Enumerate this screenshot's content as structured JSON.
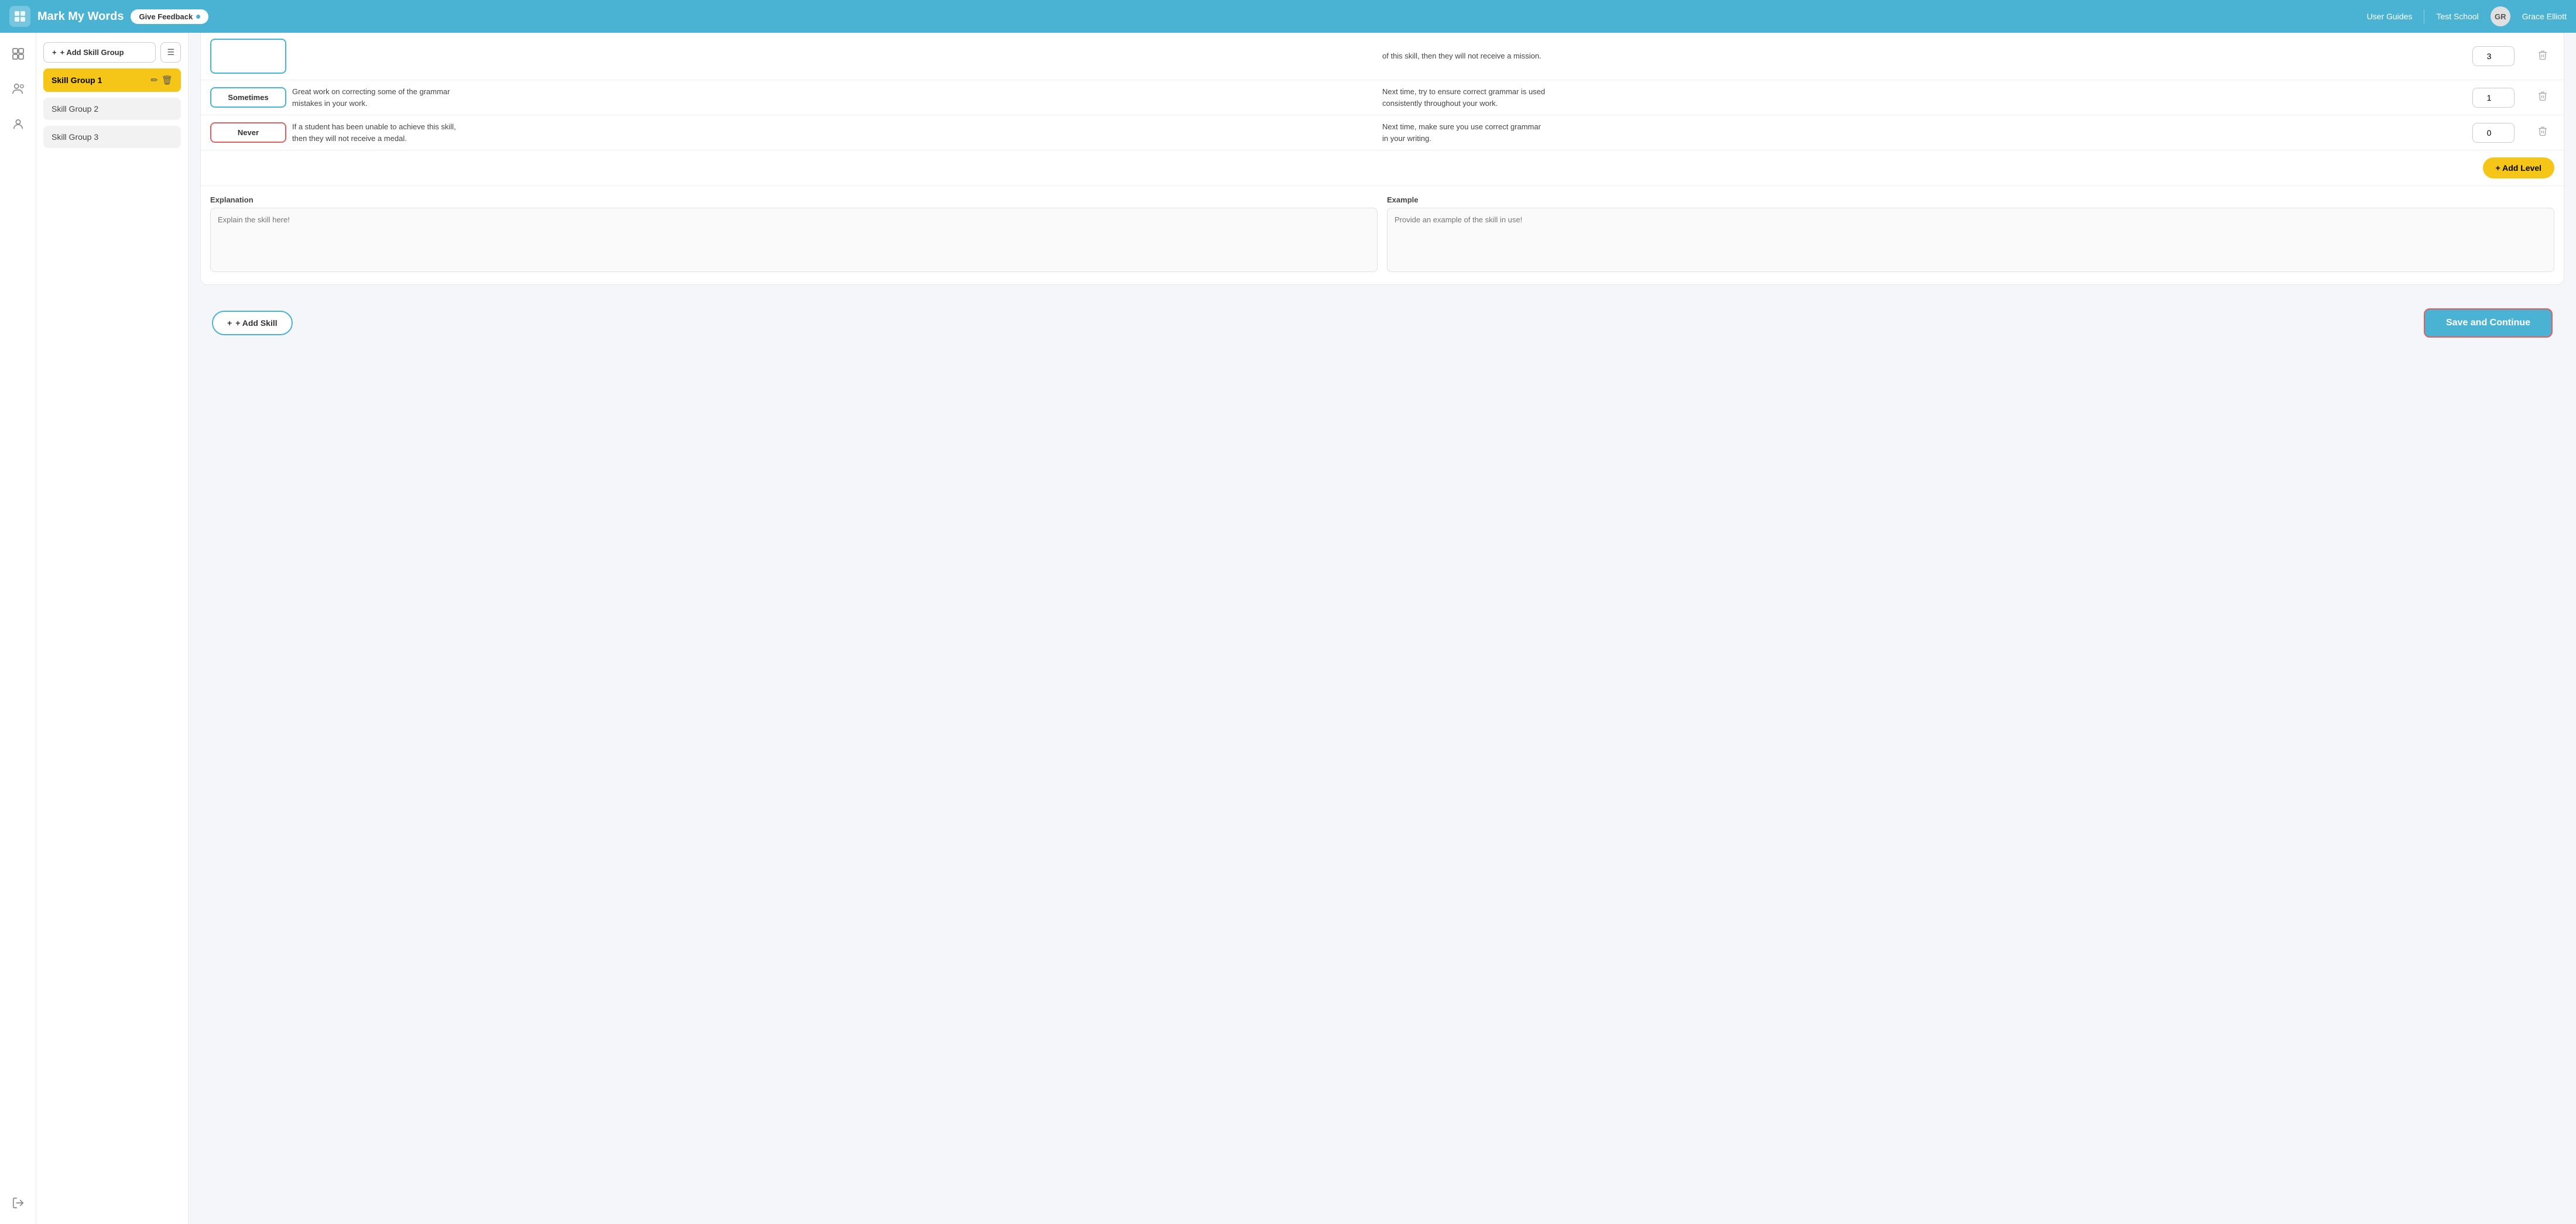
{
  "header": {
    "logo_icon": "⊞",
    "title": "Mark My Words",
    "feedback_btn": "Give Feedback",
    "nav_user_guides": "User Guides",
    "nav_test_school": "Test School",
    "avatar_initials": "GR",
    "username": "Grace Elliott"
  },
  "sidebar": {
    "add_skill_group_btn": "+ Add Skill Group",
    "items": [
      {
        "label": "Skill Group 1",
        "active": true
      },
      {
        "label": "Skill Group 2",
        "active": false
      },
      {
        "label": "Skill Group 3",
        "active": false
      }
    ]
  },
  "main": {
    "partial_top_rows": [
      {
        "badge_label": "",
        "badge_style": "plain",
        "feedback_text": "",
        "next_time_text": "of this skill, then they will not receive a mission.",
        "number": "3"
      }
    ],
    "levels": [
      {
        "badge_label": "Sometimes",
        "badge_style": "sometimes",
        "feedback_text": "Great work on correcting some of the grammar mistakes in your work.",
        "next_time_text": "Next time, try to ensure correct grammar is used consistently throughout your work.",
        "number": "1"
      },
      {
        "badge_label": "Never",
        "badge_style": "never",
        "feedback_text": "If a student has been unable to achieve this skill, then they will not receive a medal.",
        "next_time_text": "Next time, make sure you use correct grammar in your writing.",
        "number": "0"
      }
    ],
    "add_level_btn": "+ Add Level",
    "explanation_label": "Explanation",
    "explanation_placeholder": "Explain the skill here!",
    "example_label": "Example",
    "example_placeholder": "Provide an example of the skill in use!",
    "add_skill_btn": "+ Add Skill",
    "save_continue_btn": "Save and Continue"
  },
  "icons": {
    "logo": "⊞",
    "user_icon": "👤",
    "group_icon": "👥",
    "person_icon": "🧑",
    "logout_icon": "→",
    "edit_icon": "✏️",
    "delete_icon": "🗑",
    "list_icon": "☰"
  }
}
